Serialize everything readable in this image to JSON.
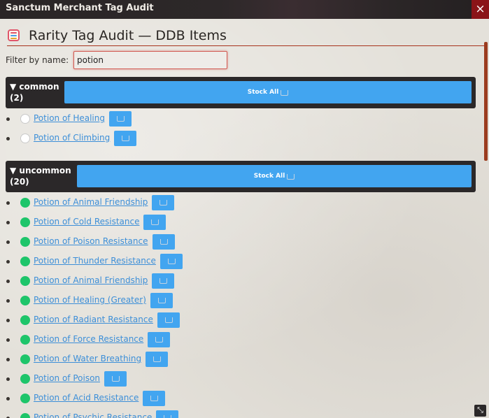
{
  "window": {
    "title": "Sanctum Merchant Tag Audit",
    "close_glyph": "×"
  },
  "header": {
    "title": "Rarity Tag Audit — DDB Items",
    "icon": "list-icon"
  },
  "filter": {
    "label": "Filter by name:",
    "value": "potion"
  },
  "groups": [
    {
      "name": "common",
      "count": "(2)",
      "stock_all_label": "Stock All",
      "rarity_color": "#ffffff",
      "items": [
        "Potion of Healing",
        "Potion of Climbing"
      ]
    },
    {
      "name": "uncommon",
      "count": "(20)",
      "stock_all_label": "Stock All",
      "rarity_color": "#1ec56a",
      "items": [
        "Potion of Animal Friendship",
        "Potion of Cold Resistance",
        "Potion of Poison Resistance",
        "Potion of Thunder Resistance",
        "Potion of Animal Friendship",
        "Potion of Healing (Greater)",
        "Potion of Radiant Resistance",
        "Potion of Force Resistance",
        "Potion of Water Breathing",
        "Potion of Poison",
        "Potion of Acid Resistance",
        "Potion of Psychic Resistance"
      ]
    }
  ],
  "colors": {
    "accent": "#42a5f0",
    "link": "#3d8fd8",
    "header_rule": "#a7331c",
    "close": "#8a1418"
  }
}
